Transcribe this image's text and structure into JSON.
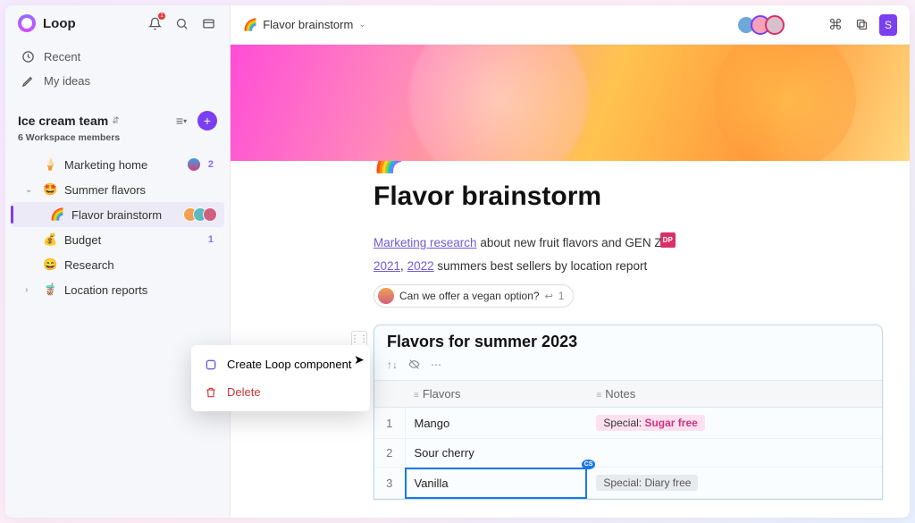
{
  "app": {
    "name": "Loop",
    "notification_count": "1"
  },
  "nav": {
    "recent": "Recent",
    "ideas": "My ideas"
  },
  "workspace": {
    "title": "Ice cream team",
    "members_line": "6 Workspace members"
  },
  "tree": {
    "marketing": {
      "emoji": "🍦",
      "label": "Marketing home",
      "badge": "2"
    },
    "summer": {
      "emoji": "🤩",
      "label": "Summer flavors"
    },
    "brainstorm": {
      "emoji": "🌈",
      "label": "Flavor brainstorm"
    },
    "budget": {
      "emoji": "💰",
      "label": "Budget",
      "badge": "1"
    },
    "research": {
      "emoji": "😄",
      "label": "Research"
    },
    "location": {
      "emoji": "🧋",
      "label": "Location reports"
    }
  },
  "breadcrumb": {
    "emoji": "🌈",
    "label": "Flavor brainstorm"
  },
  "share_btn": "S",
  "page": {
    "emoji": "🌈",
    "title": "Flavor brainstorm",
    "line1_link": "Marketing research",
    "line1_rest": " about new fruit flavors and GEN Z",
    "cursor_tag": "DP",
    "y2021": "2021",
    "y2022": "2022",
    "line2_rest": " summers best sellers by location report",
    "comment_text": "Can we offer a vegan option?",
    "comment_count": "1"
  },
  "block": {
    "title": "Flavors for summer 2023",
    "col_flavors": "Flavors",
    "col_notes": "Notes",
    "rows": [
      {
        "idx": "1",
        "flavor": "Mango",
        "note_prefix": "Special: ",
        "note_value": "Sugar free",
        "tag": "pink"
      },
      {
        "idx": "2",
        "flavor": "Sour cherry",
        "note_prefix": "",
        "note_value": "",
        "tag": ""
      },
      {
        "idx": "3",
        "flavor": "Vanilla",
        "note_prefix": "Special: ",
        "note_value": "Diary free",
        "tag": "gray"
      }
    ]
  },
  "context_menu": {
    "create": "Create Loop component",
    "delete": "Delete"
  }
}
